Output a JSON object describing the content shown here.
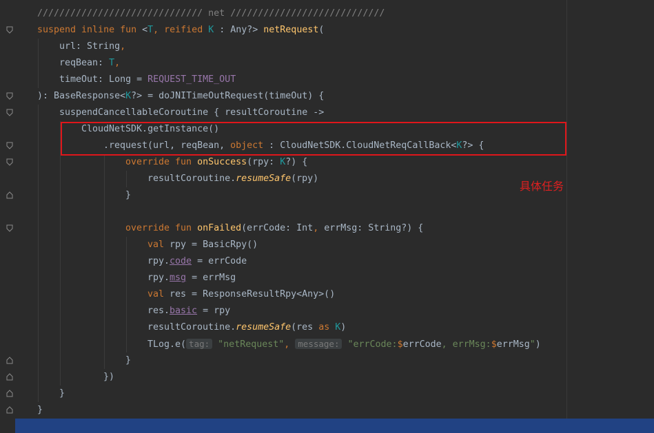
{
  "code": {
    "l1": "////////////////////////////// net ////////////////////////////",
    "l2": {
      "kw1": "suspend inline fun ",
      "lt": "<",
      "t": "T",
      "comma": ", ",
      "reified": "reified ",
      "k": "K",
      " rest": " : Any?> ",
      "name": "netRequest",
      "paren": "("
    },
    "l3": {
      "p": "url",
      "rest": ": String",
      "comma": ","
    },
    "l4": {
      "p": "reqBean",
      "rest": ": ",
      "t": "T",
      "comma": ","
    },
    "l5": {
      "p": "timeOut",
      "rest": ": Long = ",
      "c": "REQUEST_TIME_OUT"
    },
    "l6": {
      "a": "): BaseResponse<",
      "k": "K",
      "b": "?> = doJNITimeOutRequest(timeOut) {"
    },
    "l7": "suspendCancellableCoroutine { resultCoroutine ->",
    "l8": "CloudNetSDK.getInstance()",
    "l9": {
      "a": ".request(url, reqBean, ",
      "obj": "object",
      "b": " : CloudNetSDK.CloudNetReqCallBack<",
      "k": "K",
      "c": "?> {"
    },
    "l10": {
      "ov": "override fun ",
      "name": "onSuccess",
      "a": "(rpy: ",
      "k": "K",
      "b": "?) {"
    },
    "l11": {
      "a": "resultCoroutine.",
      "m": "resumeSafe",
      "b": "(rpy)"
    },
    "l12": "}",
    "l14": {
      "ov": "override fun ",
      "name": "onFailed",
      "a": "(errCode: Int",
      "comma": ", ",
      "b": "errMsg: String?) {"
    },
    "l15": {
      "kw": "val ",
      "a": "rpy = BasicRpy()"
    },
    "l16": {
      "a": "rpy.",
      "p": "code",
      "b": " = errCode"
    },
    "l17": {
      "a": "rpy.",
      "p": "msg",
      "b": " = errMsg"
    },
    "l18": {
      "kw": "val ",
      "a": "res = ResponseResultRpy<Any>()"
    },
    "l19": {
      "a": "res.",
      "p": "basic",
      "b": " = rpy"
    },
    "l20": {
      "a": "resultCoroutine.",
      "m": "resumeSafe",
      "b": "(res ",
      "as": "as ",
      "k": "K",
      "c": ")"
    },
    "l21": {
      "a": "TLog.e(",
      "h1": "tag:",
      "s1": "\"netRequest\"",
      "comma": ", ",
      "h2": "message:",
      "s2a": "\"errCode:",
      "d1": "$",
      "v1": "errCode",
      "s2b": ", errMsg:",
      "d2": "$",
      "v2": "errMsg",
      "s2c": "\"",
      "c": ")"
    },
    "l22": "}",
    "l23": "})",
    "l24": "}",
    "l25": "}"
  },
  "annotation": {
    "note": "具体任务"
  },
  "colors": {
    "background": "#2b2b2b",
    "keyword": "#cc7832",
    "function": "#ffc66d",
    "type_param": "#20999d",
    "constant": "#9876aa",
    "string": "#6a8759",
    "highlight_box": "#e0161b",
    "note": "#e02020",
    "selection_bar": "#214283"
  }
}
